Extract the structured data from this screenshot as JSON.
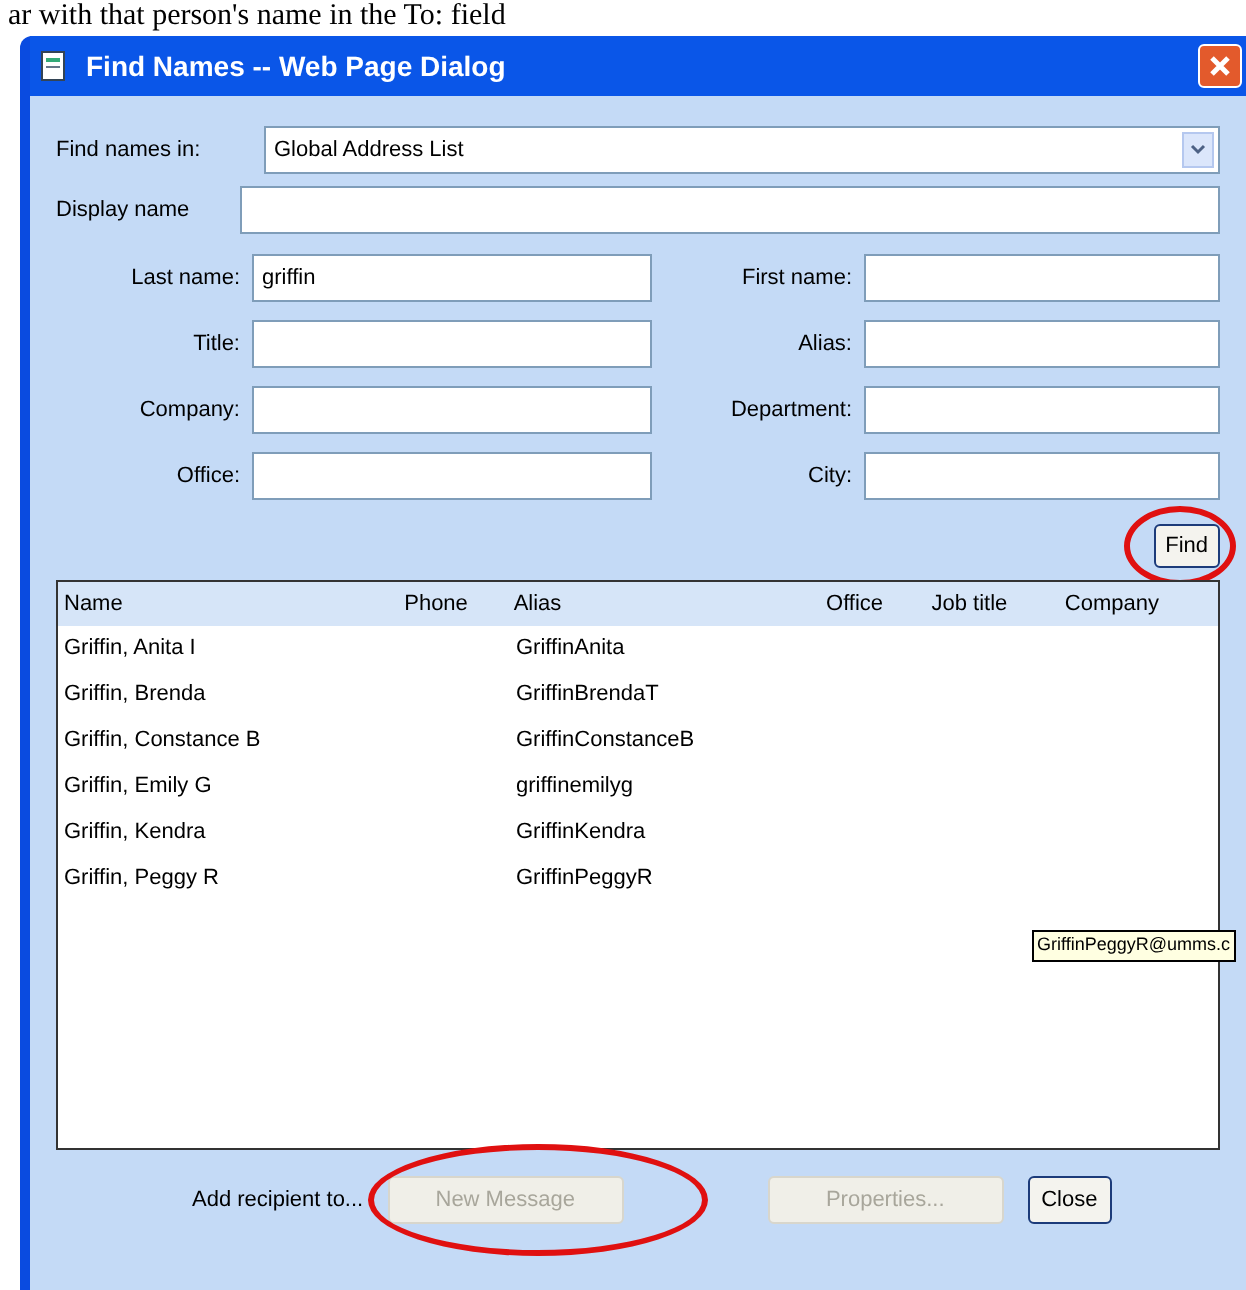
{
  "caption": "ar with that person's name in the To: field",
  "window": {
    "title": "Find Names -- Web Page Dialog"
  },
  "find_in": {
    "label": "Find names in:",
    "value": "Global Address List"
  },
  "display_name": {
    "label": "Display name"
  },
  "fields": [
    {
      "label": "Last name:",
      "value": "griffin"
    },
    {
      "label": "First name:"
    },
    {
      "label": "Title:"
    },
    {
      "label": "Alias:"
    },
    {
      "label": "Company:"
    },
    {
      "label": "Department:"
    },
    {
      "label": "Office:"
    },
    {
      "label": "City:"
    }
  ],
  "find_button": {
    "label": "Find",
    "circled": true
  },
  "table": {
    "columns": [
      "Name",
      "Phone",
      "Alias",
      "Office",
      "Job title",
      "Company"
    ],
    "rows": [
      [
        "Griffin, Anita I",
        "",
        "GriffinAnita"
      ],
      [
        "Griffin, Brenda",
        "",
        "GriffinBrendaT"
      ],
      [
        "Griffin, Constance B",
        "",
        "GriffinConstanceB"
      ],
      [
        "Griffin, Emily G",
        "",
        "griffinemilyg"
      ],
      [
        "Griffin, Kendra",
        "",
        "GriffinKendra"
      ],
      [
        "Griffin, Peggy R",
        "",
        "GriffinPeggyR"
      ]
    ]
  },
  "tooltip": "GriffinPeggyR@umms.c",
  "footer": {
    "label": "Add recipient to...",
    "buttons": [
      {
        "label": "New Message",
        "disabled": true,
        "circled": true
      },
      {
        "label": "Properties...",
        "disabled": true,
        "circled": false
      },
      {
        "label": "Close",
        "disabled": false,
        "circled": false
      }
    ]
  }
}
